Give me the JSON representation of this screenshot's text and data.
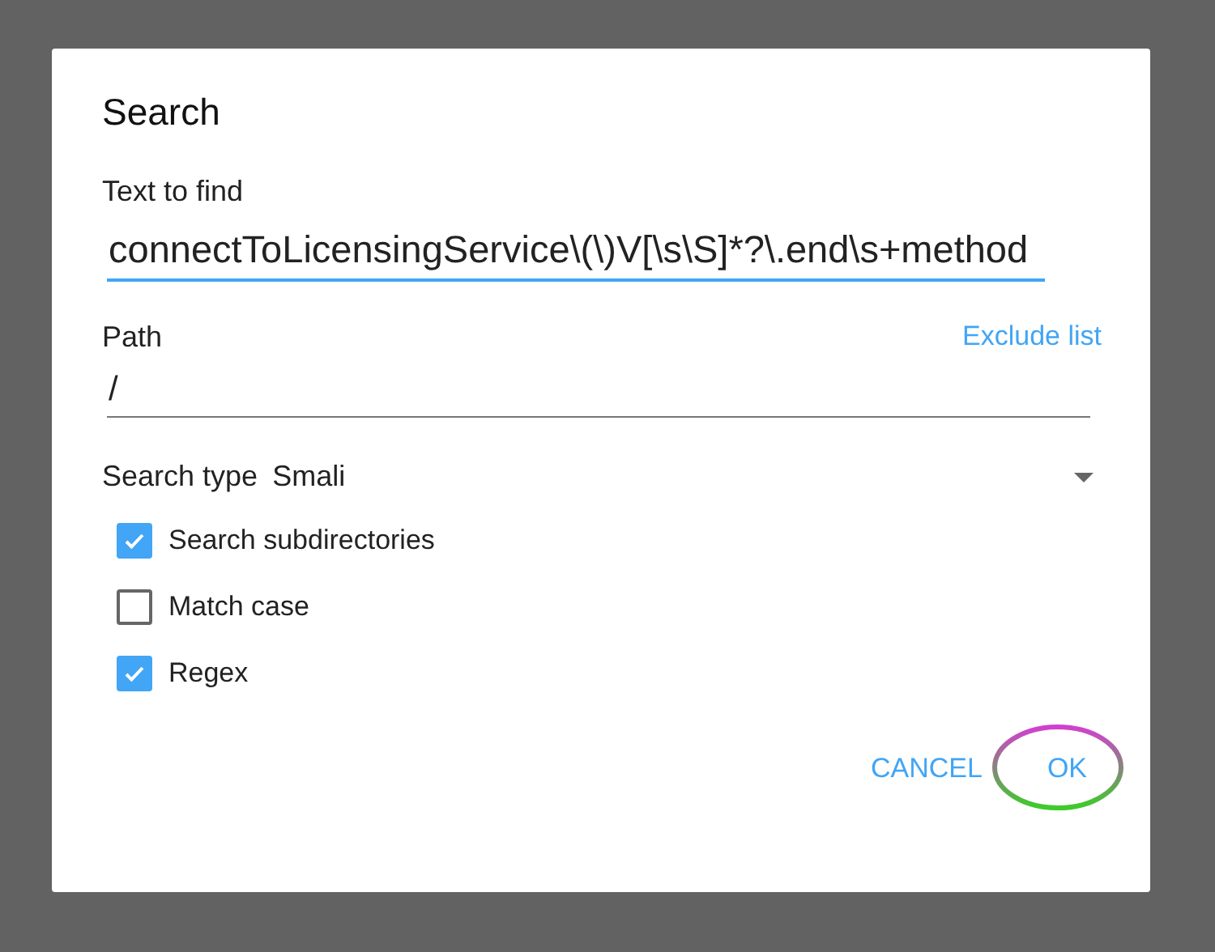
{
  "dialog": {
    "title": "Search",
    "text_field": {
      "label": "Text to find",
      "value": "connectToLicensingService\\(\\)V[\\s\\S]*?\\.end\\s+method",
      "focused": true
    },
    "path_field": {
      "label": "Path",
      "value": "/",
      "link": "Exclude list"
    },
    "search_type": {
      "label": "Search type",
      "value": "Smali"
    },
    "options": [
      {
        "label": "Search subdirectories",
        "checked": true
      },
      {
        "label": "Match case",
        "checked": false
      },
      {
        "label": "Regex",
        "checked": true
      }
    ],
    "buttons": [
      {
        "label": "CANCEL",
        "highlighted": false
      },
      {
        "label": "OK",
        "highlighted": true
      }
    ]
  }
}
